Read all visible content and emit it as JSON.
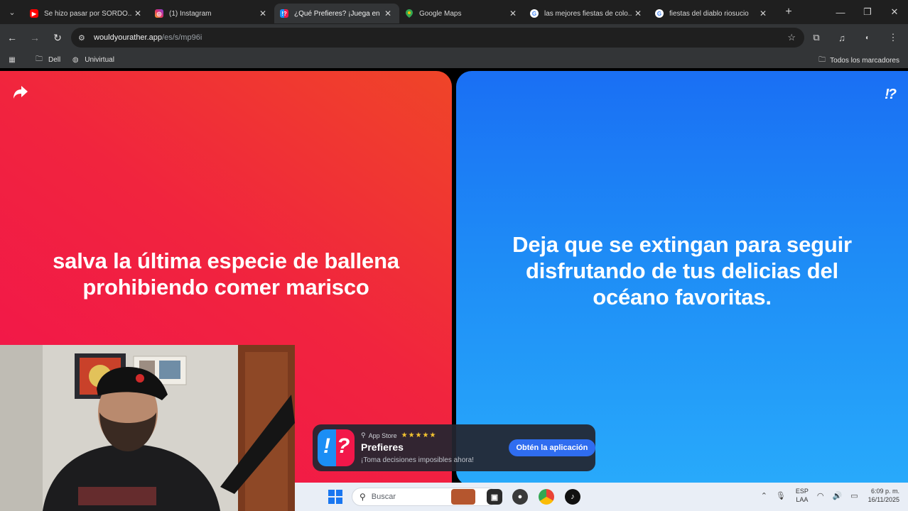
{
  "browser": {
    "tabs": [
      {
        "title": "Se hizo pasar por SORDO...",
        "icon": "youtube-icon",
        "color": "#ff0000"
      },
      {
        "title": "(1) Instagram",
        "icon": "instagram-icon",
        "color": "#e1306c"
      },
      {
        "title": "¿Qué Prefieres? ¡Juega en ...",
        "icon": "prefieres-icon",
        "color": "#2f6df0",
        "active": true
      },
      {
        "title": "Google Maps",
        "icon": "maps-pin-icon",
        "color": "#34a853"
      },
      {
        "title": "las mejores fiestas de colo...",
        "icon": "google-icon",
        "color": "#4285f4"
      },
      {
        "title": "fiestas del diablo riosucio",
        "icon": "google-icon",
        "color": "#4285f4"
      }
    ],
    "url_host": "wouldyourather.app",
    "url_path": "/es/s/mp96i",
    "bookmarks": [
      {
        "label": "Dell",
        "icon": "folder-icon"
      },
      {
        "label": "Univirtual",
        "icon": "globe-icon"
      }
    ],
    "all_bookmarks": "Todos los marcadores"
  },
  "game": {
    "option_a": "salva la última especie de ballena prohibiendo comer marisco",
    "option_b": "Deja que se extingan para seguir disfrutando de tus delicias del océano favoritas.",
    "logo": "!?",
    "colors": {
      "red": "#f2124e",
      "blue": "#1e8cf6"
    }
  },
  "promo": {
    "store": "App Store",
    "stars": "★★★★★",
    "app_name": "Prefieres",
    "tagline": "¡Toma decisiones imposibles ahora!",
    "cta": "Obtén la aplicación"
  },
  "taskbar": {
    "search_placeholder": "Buscar",
    "lang_top": "ESP",
    "lang_bottom": "LAA",
    "time": "6:09 p. m.",
    "date": "16/11/2025"
  }
}
